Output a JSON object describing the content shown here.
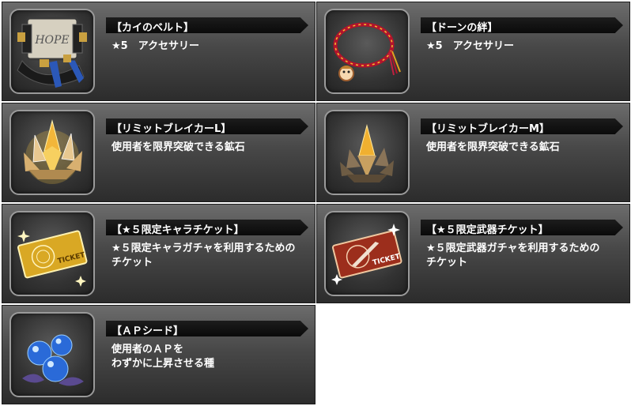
{
  "items": [
    {
      "name": "【カイのベルト】",
      "desc": [
        "★5　アクセサリー"
      ],
      "icon": "belt-icon"
    },
    {
      "name": "【ドーンの絆】",
      "desc": [
        "★5　アクセサリー"
      ],
      "icon": "necklace-icon"
    },
    {
      "name": "【リミットブレイカーL】",
      "desc": [
        "使用者を限界突破できる鉱石"
      ],
      "icon": "crystal-large-icon"
    },
    {
      "name": "【リミットブレイカーM】",
      "desc": [
        "使用者を限界突破できる鉱石"
      ],
      "icon": "crystal-medium-icon"
    },
    {
      "name": "【★５限定キャラチケット】",
      "desc": [
        "★５限定キャラガチャを利用するための",
        "チケット"
      ],
      "icon": "gold-ticket-icon"
    },
    {
      "name": "【★５限定武器チケット】",
      "desc": [
        "★５限定武器ガチャを利用するための",
        "チケット"
      ],
      "icon": "weapon-ticket-icon"
    },
    {
      "name": "【ＡＰシード】",
      "desc": [
        "使用者のＡＰを",
        "わずかに上昇させる種"
      ],
      "icon": "seed-icon"
    }
  ],
  "thumb_labels": {
    "belt_label": "HOPE",
    "ticket_label": "TICKET"
  },
  "colors": {
    "card_top": "#6c6c6c",
    "card_bottom": "#2c2c2c",
    "name_bar": "#111111",
    "text": "#ffffff"
  }
}
